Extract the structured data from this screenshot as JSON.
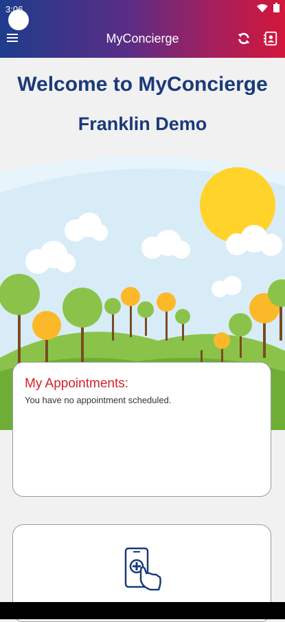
{
  "status_bar": {
    "time": "3:06",
    "icons": [
      "wifi-icon",
      "battery-icon"
    ]
  },
  "app_bar": {
    "title": "MyConcierge",
    "icons": [
      "menu-icon",
      "refresh-icon",
      "contact-card-icon"
    ]
  },
  "welcome": {
    "heading": "Welcome to MyConcierge",
    "subtitle": "Franklin Demo"
  },
  "appointments": {
    "title": "My Appointments:",
    "empty_message": "You have no appointment scheduled."
  },
  "colors": {
    "header_gradient_start": "#1f3c8c",
    "header_gradient_end": "#d2173b",
    "heading_blue": "#1a3a7a",
    "accent_red": "#d4202a"
  }
}
